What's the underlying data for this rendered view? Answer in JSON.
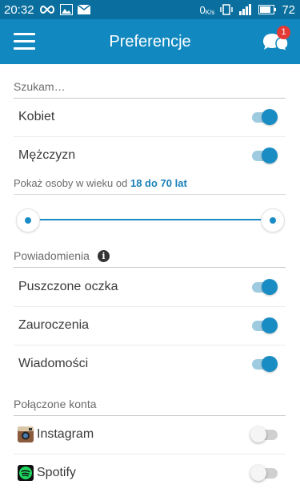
{
  "status_bar": {
    "time": "20:32",
    "data_rate": "0",
    "data_rate_unit": "K/s",
    "battery": "72"
  },
  "app_bar": {
    "title": "Preferencje",
    "chat_badge": "1",
    "icons": [
      "menu-icon",
      "chat-bubbles-icon"
    ]
  },
  "search": {
    "header": "Szukam…",
    "items": [
      {
        "label": "Kobiet",
        "on": true
      },
      {
        "label": "Mężczyzn",
        "on": true
      }
    ]
  },
  "age": {
    "prefix": "Pokaż osoby w wieku od",
    "value": "18 do 70 lat",
    "min": 18,
    "max": 70
  },
  "notifications": {
    "header": "Powiadomienia",
    "info_icon": "info-icon",
    "items": [
      {
        "label": "Puszczone oczka",
        "on": true
      },
      {
        "label": "Zauroczenia",
        "on": true
      },
      {
        "label": "Wiadomości",
        "on": true
      }
    ]
  },
  "accounts": {
    "header": "Połączone konta",
    "items": [
      {
        "label": "Instagram",
        "icon": "instagram-icon",
        "on": false
      },
      {
        "label": "Spotify",
        "icon": "spotify-icon",
        "on": false
      }
    ]
  },
  "colors": {
    "app_bar": "#1188c0",
    "status_bar": "#0a6f9e",
    "accent": "#1a8cc4",
    "badge": "#e53935"
  }
}
